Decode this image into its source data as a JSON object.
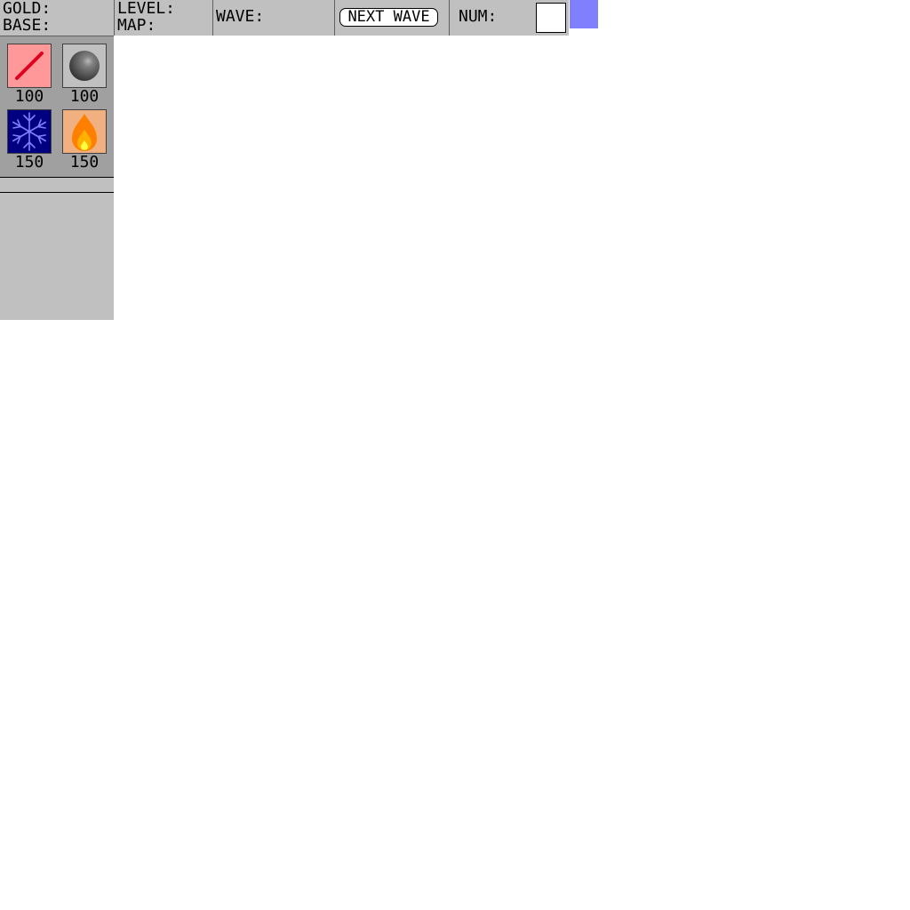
{
  "topbar": {
    "gold_label": "GOLD:",
    "base_label": "BASE:",
    "level_label": "LEVEL:",
    "map_label": "MAP:",
    "wave_label": "WAVE:",
    "next_wave_label": "NEXT WAVE",
    "num_label": "NUM:",
    "num_value": ""
  },
  "towers": [
    {
      "name": "laser",
      "price": "100",
      "icon": "laser-icon",
      "bg": "#ff9999",
      "accent": "#e00020"
    },
    {
      "name": "cannon",
      "price": "100",
      "icon": "cannonball-icon",
      "bg": "#c0c0c0",
      "accent": "#505050"
    },
    {
      "name": "ice",
      "price": "150",
      "icon": "snowflake-icon",
      "bg": "#000080",
      "accent": "#8080ff"
    },
    {
      "name": "fire",
      "price": "150",
      "icon": "flame-icon",
      "bg": "#f0b080",
      "accent": "#ff8000"
    }
  ],
  "colors": {
    "panel": "#c0c0c0",
    "shop_bg": "#a0a0a0",
    "indicator": "#8080ff"
  }
}
